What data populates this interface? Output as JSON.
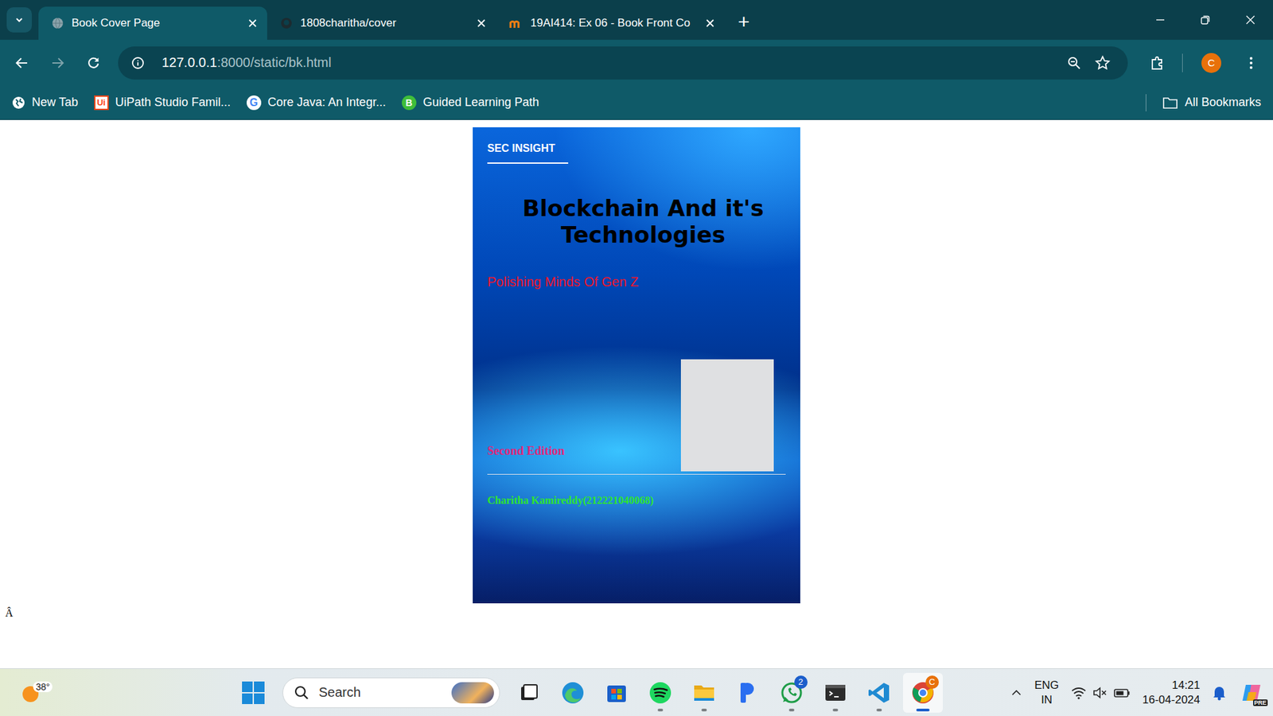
{
  "browser": {
    "tabs": [
      {
        "title": "Book Cover Page",
        "selected": true
      },
      {
        "title": "1808charitha/cover",
        "selected": false
      },
      {
        "title": "19AI414: Ex 06 - Book Front Co",
        "selected": false
      }
    ],
    "new_tab": "+",
    "address": {
      "host": "127.0.0.1",
      "rest": ":8000/static/bk.html"
    },
    "profile": "C",
    "bookmarks": [
      {
        "label": "New Tab",
        "kind": "globe",
        "mark": ""
      },
      {
        "label": "UiPath Studio Famil...",
        "kind": "uipath",
        "mark": "Ui"
      },
      {
        "label": "Core Java: An Integr...",
        "kind": "google",
        "mark": "G"
      },
      {
        "label": "Guided Learning Path",
        "kind": "guided",
        "mark": "B"
      }
    ],
    "all_bookmarks": "All Bookmarks"
  },
  "page": {
    "cover": {
      "brand": "SEC INSIGHT",
      "title": "Blockchain And it's Technologies",
      "subtitle": "Polishing Minds Of Gen Z",
      "edition": "Second Edition",
      "author": "Charitha Kamireddy(212221040068)"
    },
    "stray_text": "Â"
  },
  "taskbar": {
    "weather": "38°",
    "search": "Search",
    "apps": [
      {
        "kind": "taskview",
        "running": false,
        "active": false,
        "badge": ""
      },
      {
        "kind": "edge",
        "running": false,
        "active": false,
        "badge": ""
      },
      {
        "kind": "store",
        "running": false,
        "active": false,
        "badge": ""
      },
      {
        "kind": "spotify",
        "running": true,
        "active": false,
        "badge": ""
      },
      {
        "kind": "explorer",
        "running": true,
        "active": false,
        "badge": ""
      },
      {
        "kind": "pandora",
        "running": false,
        "active": false,
        "badge": ""
      },
      {
        "kind": "whatsapp",
        "running": true,
        "active": false,
        "badge": "2"
      },
      {
        "kind": "terminal",
        "running": true,
        "active": false,
        "badge": ""
      },
      {
        "kind": "vscode",
        "running": true,
        "active": false,
        "badge": ""
      },
      {
        "kind": "chrome",
        "running": true,
        "active": true,
        "badge": "C"
      }
    ],
    "language": "ENG",
    "region": "IN",
    "time": "14:21",
    "date": "16-04-2024",
    "copilot": "PRE"
  }
}
